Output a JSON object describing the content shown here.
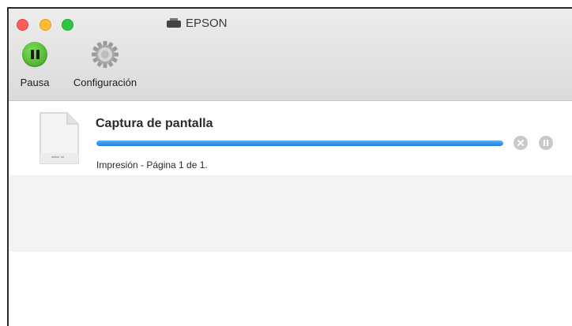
{
  "window": {
    "title": "EPSON"
  },
  "toolbar": {
    "pause_label": "Pausa",
    "settings_label": "Configuración"
  },
  "job": {
    "name": "Captura de pantalla",
    "status": "Impresión - Página 1 de 1.",
    "progress": 1.0
  },
  "colors": {
    "close": "#fc5f57",
    "minimize": "#fdbc2e",
    "zoom": "#2ac840",
    "progress": "#2f8ee8",
    "pause_green": "#4cb82c"
  }
}
